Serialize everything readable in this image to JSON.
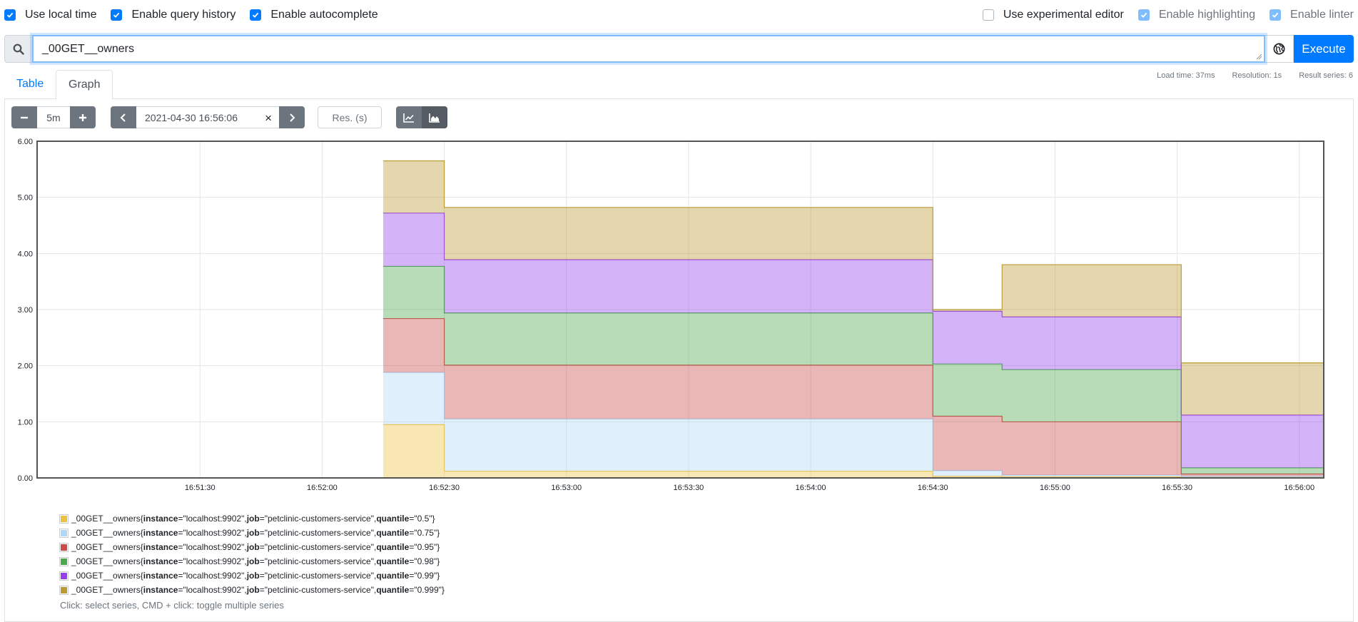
{
  "options": {
    "left": [
      {
        "label": "Use local time",
        "checked": true
      },
      {
        "label": "Enable query history",
        "checked": true
      },
      {
        "label": "Enable autocomplete",
        "checked": true
      }
    ],
    "right": [
      {
        "label": "Use experimental editor",
        "checked": false
      },
      {
        "label": "Enable highlighting",
        "checked": true
      },
      {
        "label": "Enable linter",
        "checked": true
      }
    ]
  },
  "query": {
    "value": "_00GET__owners",
    "execute_label": "Execute",
    "search_icon": "search-icon",
    "globe_icon": "globe-icon"
  },
  "tabs": {
    "table": "Table",
    "graph": "Graph"
  },
  "stats": {
    "load_time": "Load time: 37ms",
    "resolution": "Resolution: 1s",
    "result_series": "Result series: 6"
  },
  "graph_controls": {
    "decrease": "−",
    "range": "5m",
    "increase": "+",
    "end_time": "2021-04-30 16:56:06",
    "clear": "×",
    "resolution_placeholder": "Res. (s)"
  },
  "chart_data": {
    "type": "area",
    "stacked": true,
    "ylim": [
      0,
      6
    ],
    "yticks": [
      "0.00",
      "1.00",
      "2.00",
      "3.00",
      "4.00",
      "5.00",
      "6.00"
    ],
    "xticks": [
      "16:51:30",
      "16:52:00",
      "16:52:30",
      "16:53:00",
      "16:53:30",
      "16:54:00",
      "16:54:30",
      "16:55:00",
      "16:55:30",
      "16:56:00"
    ],
    "xlim_seconds": [
      -310,
      6
    ],
    "x_note": "x values are seconds relative to 16:56:00",
    "x": [
      -225,
      -211,
      -210,
      -30,
      -29,
      -18,
      -17,
      14,
      15,
      5,
      6
    ],
    "x_breaks": [
      -225,
      -211,
      -210,
      -91,
      -90,
      -74,
      -73,
      -30,
      -29,
      6
    ],
    "series": [
      {
        "name": "_00GET__owners{instance=\"localhost:9902\", job=\"petclinic-customers-service\", quantile=\"0.5\"}",
        "color": "#edc240",
        "values": [
          0.95,
          0.95,
          0.12,
          0.12,
          0.03,
          0.03,
          0.02,
          0.02,
          0.01,
          0.01
        ]
      },
      {
        "name": "_00GET__owners{instance=\"localhost:9902\", job=\"petclinic-customers-service\", quantile=\"0.75\"}",
        "color": "#afd8f8",
        "values": [
          0.93,
          0.93,
          0.93,
          0.93,
          0.1,
          0.1,
          0.03,
          0.03,
          0.02,
          0.02
        ]
      },
      {
        "name": "_00GET__owners{instance=\"localhost:9902\", job=\"petclinic-customers-service\", quantile=\"0.95\"}",
        "color": "#cb4b4b",
        "values": [
          0.96,
          0.96,
          0.96,
          0.96,
          0.97,
          0.97,
          0.95,
          0.95,
          0.04,
          0.04
        ]
      },
      {
        "name": "_00GET__owners{instance=\"localhost:9902\", job=\"petclinic-customers-service\", quantile=\"0.98\"}",
        "color": "#4da74d",
        "values": [
          0.93,
          0.93,
          0.93,
          0.93,
          0.93,
          0.93,
          0.93,
          0.93,
          0.11,
          0.11
        ]
      },
      {
        "name": "_00GET__owners{instance=\"localhost:9902\", job=\"petclinic-customers-service\", quantile=\"0.99\"}",
        "color": "#9440ed",
        "values": [
          0.95,
          0.95,
          0.95,
          0.95,
          0.94,
          0.94,
          0.94,
          0.94,
          0.94,
          0.94
        ]
      },
      {
        "name": "_00GET__owners{instance=\"localhost:9902\", job=\"petclinic-customers-service\", quantile=\"0.999\"}",
        "color": "#bd9b33",
        "values": [
          0.93,
          0.93,
          0.93,
          0.93,
          0.03,
          0.03,
          0.93,
          0.93,
          0.93,
          0.93
        ]
      }
    ],
    "legend": "bottom"
  },
  "legend": {
    "metric": "_00GET__owners",
    "entries": [
      {
        "instance": "\"localhost:9902\"",
        "job": "\"petclinic-customers-service\"",
        "quantile": "\"0.5\"",
        "color": "#edc240"
      },
      {
        "instance": "\"localhost:9902\"",
        "job": "\"petclinic-customers-service\"",
        "quantile": "\"0.75\"",
        "color": "#afd8f8"
      },
      {
        "instance": "\"localhost:9902\"",
        "job": "\"petclinic-customers-service\"",
        "quantile": "\"0.95\"",
        "color": "#cb4b4b"
      },
      {
        "instance": "\"localhost:9902\"",
        "job": "\"petclinic-customers-service\"",
        "quantile": "\"0.98\"",
        "color": "#4da74d"
      },
      {
        "instance": "\"localhost:9902\"",
        "job": "\"petclinic-customers-service\"",
        "quantile": "\"0.99\"",
        "color": "#9440ed"
      },
      {
        "instance": "\"localhost:9902\"",
        "job": "\"petclinic-customers-service\"",
        "quantile": "\"0.999\"",
        "color": "#bd9b33"
      }
    ],
    "hint": "Click: select series, CMD + click: toggle multiple series"
  }
}
